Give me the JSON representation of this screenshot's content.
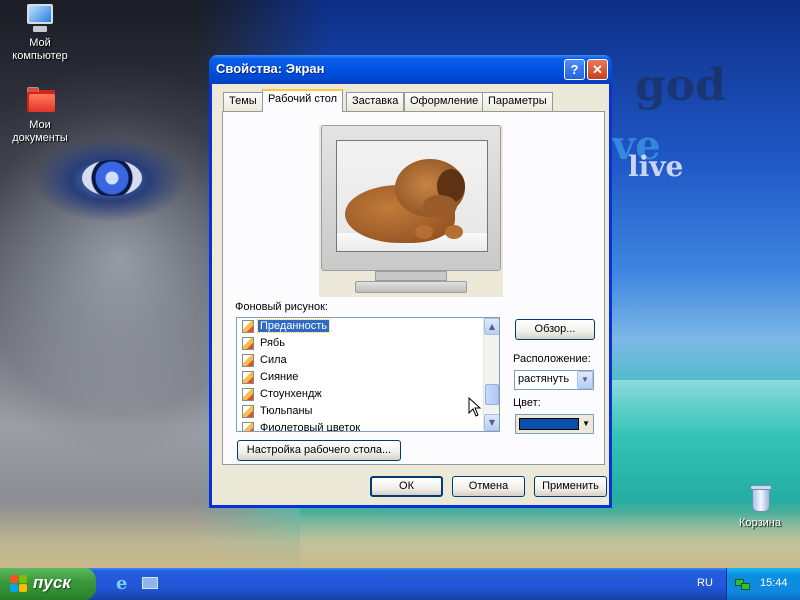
{
  "desktop": {
    "wallpaper_text": [
      "god",
      "ve",
      "live"
    ],
    "icons": [
      {
        "label_line1": "Мой",
        "label_line2": "компьютер",
        "icon": "my-computer-icon"
      },
      {
        "label_line1": "Мои",
        "label_line2": "документы",
        "icon": "my-documents-folder-icon"
      },
      {
        "label_line1": "Корзина",
        "label_line2": "",
        "icon": "recycle-bin-icon"
      }
    ]
  },
  "dialog": {
    "title": "Свойства: Экран",
    "help_glyph": "?",
    "close_glyph": "✕",
    "tabs": [
      {
        "label": "Темы",
        "active": false
      },
      {
        "label": "Рабочий стол",
        "active": true
      },
      {
        "label": "Заставка",
        "active": false
      },
      {
        "label": "Оформление",
        "active": false
      },
      {
        "label": "Параметры",
        "active": false
      }
    ],
    "wallpaper_label": "Фоновый рисунок:",
    "wallpaper_items": [
      {
        "label": "Преданность",
        "selected": true
      },
      {
        "label": "Рябь",
        "selected": false
      },
      {
        "label": "Сила",
        "selected": false
      },
      {
        "label": "Сияние",
        "selected": false
      },
      {
        "label": "Стоунхендж",
        "selected": false
      },
      {
        "label": "Тюльпаны",
        "selected": false
      },
      {
        "label": "Фиолетовый цветок",
        "selected": false
      }
    ],
    "browse_button": "Обзор...",
    "position_label": "Расположение:",
    "position_value": "растянуть",
    "color_label": "Цвет:",
    "color_value": "#0a4fa8",
    "customize_button": "Настройка рабочего стола...",
    "ok_button": "ОК",
    "cancel_button": "Отмена",
    "apply_button": "Применить"
  },
  "taskbar": {
    "start_label": "пуск",
    "quick_launch": [
      "internet-explorer-icon",
      "show-desktop-icon"
    ],
    "language": "RU",
    "clock": "15:44"
  },
  "colors": {
    "titlebar_blue": "#0054e3",
    "taskbar_blue": "#245edc",
    "start_green": "#3c9a3c",
    "selection_blue": "#316ac5"
  }
}
